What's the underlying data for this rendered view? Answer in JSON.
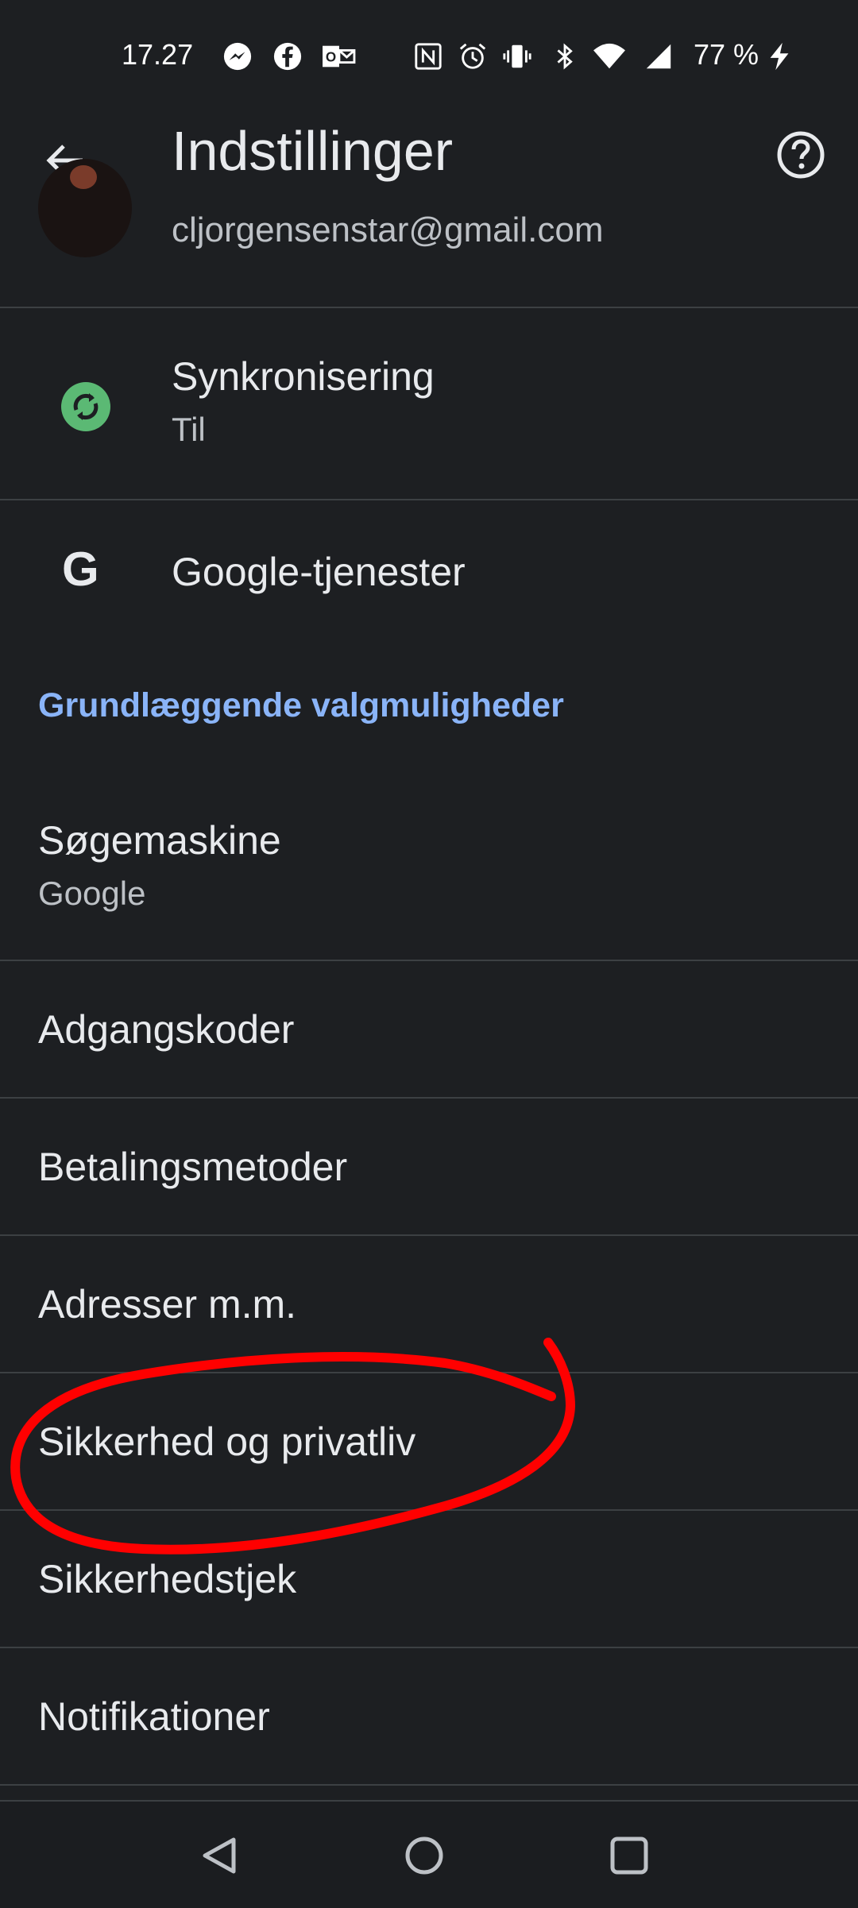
{
  "status_bar": {
    "time": "17.27",
    "battery": "77 %",
    "icons": [
      "messenger-icon",
      "facebook-icon",
      "outlook-icon",
      "nfc-icon",
      "alarm-icon",
      "vibrate-icon",
      "bluetooth-icon",
      "wifi-icon",
      "signal-icon",
      "charging-icon"
    ]
  },
  "toolbar": {
    "title": "Indstillinger",
    "back_icon": "arrow-left-icon",
    "help_icon": "help-circle-icon"
  },
  "account": {
    "email": "cljorgensenstar@gmail.com"
  },
  "sync": {
    "label": "Synkronisering",
    "status": "Til",
    "icon_color": "#5bb974"
  },
  "google_services": {
    "label": "Google-tjenester"
  },
  "basics": {
    "header": "Grundlæggende valgmuligheder",
    "accent_color": "#8ab4f8",
    "items": [
      {
        "label": "Søgemaskine",
        "value": "Google"
      },
      {
        "label": "Adgangskoder"
      },
      {
        "label": "Betalingsmetoder"
      },
      {
        "label": "Adresser m.m."
      },
      {
        "label": "Sikkerhed og privatliv"
      },
      {
        "label": "Sikkerhedstjek"
      },
      {
        "label": "Notifikationer"
      }
    ]
  },
  "annotation": {
    "color": "#ff0000",
    "target": "Sikkerhed og privatliv"
  },
  "nav_bar": {
    "icons": [
      "nav-back-icon",
      "nav-home-icon",
      "nav-recents-icon"
    ]
  }
}
